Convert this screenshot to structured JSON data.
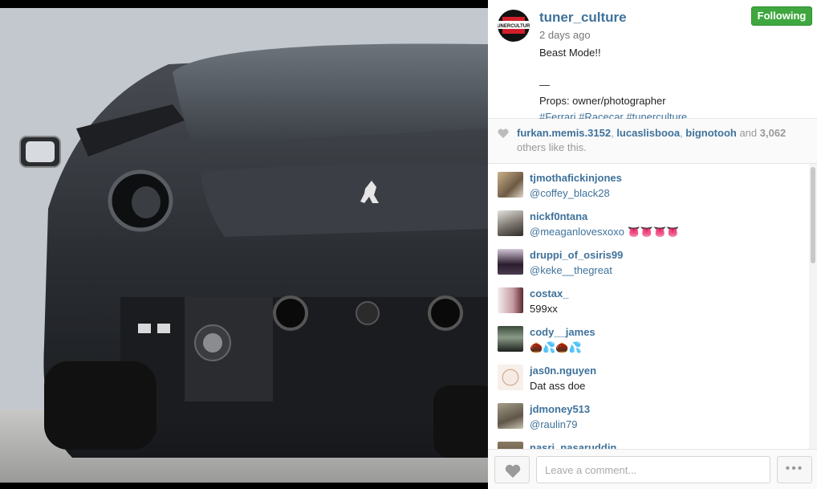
{
  "post": {
    "username": "tuner_culture",
    "follow_label": "Following",
    "time": "2 days ago",
    "caption_line1": "Beast Mode!!",
    "caption_dash": "—",
    "caption_line2": "Props: owner/photographer",
    "caption_tags": "#Ferrari #Racecar #tunerculture",
    "avatar_logo_text": "TUNER CULTURE"
  },
  "likes": {
    "user1": "furkan.memis.3152",
    "sep1": ", ",
    "user2": "lucaslisbooa",
    "sep2": ", ",
    "user3": "bignotooh",
    "and": " and ",
    "count": "3,062",
    "suffix": " others like this."
  },
  "comments": [
    {
      "author": "tjmothafickinjones",
      "text": "@coffey_black28",
      "mention": true
    },
    {
      "author": "nickf0ntana",
      "text": "@meaganlovesxoxo 👅👅👅👅",
      "mention": true
    },
    {
      "author": "druppi_of_osiris99",
      "text": "@keke__thegreat",
      "mention": true
    },
    {
      "author": "costax_",
      "text": "599xx",
      "mention": false
    },
    {
      "author": "cody__james",
      "text": "🌰💦🌰💦",
      "mention": false
    },
    {
      "author": "jas0n.nguyen",
      "text": "Dat ass doe",
      "mention": false
    },
    {
      "author": "jdmoney513",
      "text": "@raulin79",
      "mention": true
    },
    {
      "author": "nasri_nasaruddin",
      "text": "",
      "mention": false
    }
  ],
  "footer": {
    "comment_placeholder": "Leave a comment...",
    "more_label": "•••"
  },
  "colors": {
    "link": "#3f729b",
    "follow_green": "#3fa73f"
  }
}
